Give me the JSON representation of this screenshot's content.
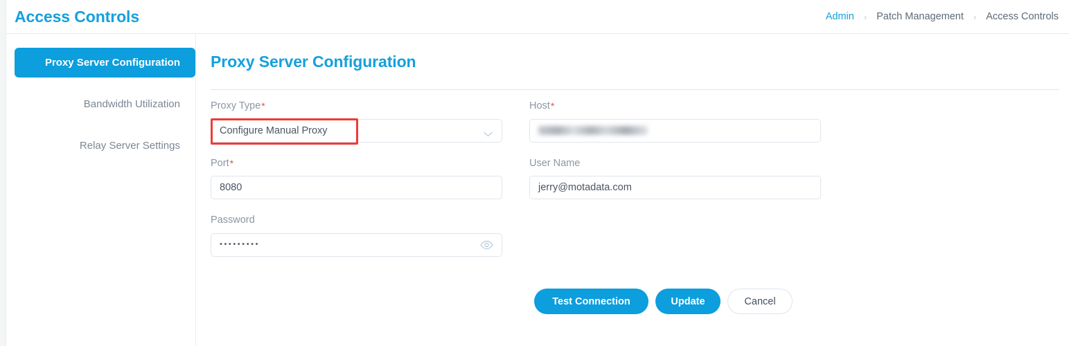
{
  "header": {
    "title": "Access Controls",
    "breadcrumb": [
      {
        "label": "Admin",
        "link": true
      },
      {
        "label": "Patch Management",
        "link": false
      },
      {
        "label": "Access Controls",
        "link": false
      }
    ],
    "separator": "›"
  },
  "sidebar": {
    "items": [
      {
        "label": "Proxy Server Configuration",
        "active": true
      },
      {
        "label": "Bandwidth Utilization",
        "active": false
      },
      {
        "label": "Relay Server Settings",
        "active": false
      }
    ]
  },
  "main": {
    "section_title": "Proxy Server Configuration",
    "required_marker": "*",
    "fields": {
      "proxy_type": {
        "label": "Proxy Type",
        "required": true,
        "value": "Configure Manual Proxy",
        "highlighted": true
      },
      "host": {
        "label": "Host",
        "required": true,
        "value": "",
        "redacted": true
      },
      "port": {
        "label": "Port",
        "required": true,
        "value": "8080"
      },
      "user_name": {
        "label": "User Name",
        "required": false,
        "value": "jerry@motadata.com"
      },
      "password": {
        "label": "Password",
        "required": false,
        "value": "•••••••••"
      }
    },
    "buttons": {
      "test_connection": "Test Connection",
      "update": "Update",
      "cancel": "Cancel"
    }
  },
  "colors": {
    "accent": "#0c9edd",
    "title": "#14a0dd",
    "required": "#ef4b4b",
    "annotation": "#ef3b36",
    "label": "#8b96a3",
    "border": "#dfe5ed"
  }
}
